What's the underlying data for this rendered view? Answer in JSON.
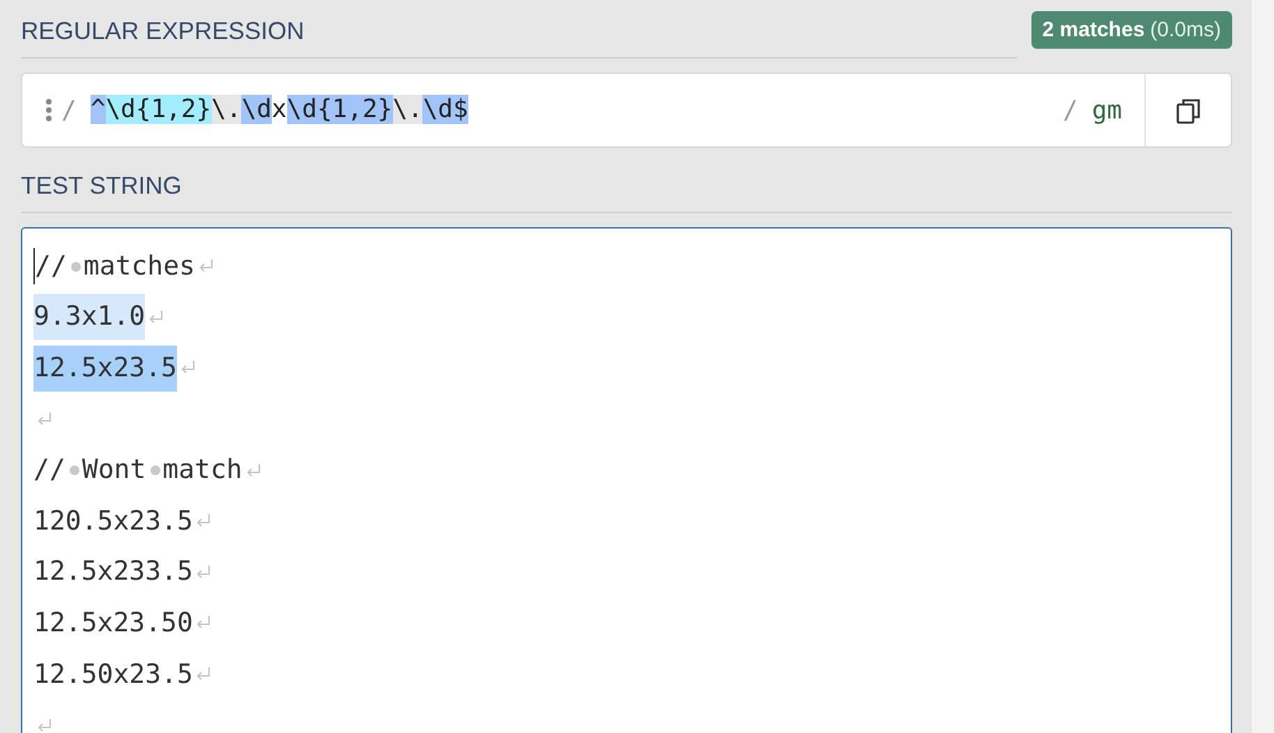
{
  "regex_section": {
    "title": "REGULAR EXPRESSION",
    "badge": {
      "count": "2 matches",
      "time": "(0.0ms)"
    },
    "delimiter_open": "/",
    "tokens": [
      {
        "text": "^",
        "color": "#a3c4f9"
      },
      {
        "text": "\\d{1,2}",
        "color": "#a3ecfb"
      },
      {
        "text": "\\.",
        "color": "#e6e6e6"
      },
      {
        "text": "\\d",
        "color": "#a3c4f9"
      },
      {
        "text": "x"
      },
      {
        "text": "\\d{1,2}",
        "color": "#a3c4f9"
      },
      {
        "text": "\\.",
        "color": "#e6e6e6"
      },
      {
        "text": "\\d$",
        "color": "#a3c4f9"
      }
    ],
    "delimiter_close": "/",
    "flags": "gm"
  },
  "test_section": {
    "title": "TEST STRING",
    "lines": [
      {
        "kind": "text",
        "text": "// matches"
      },
      {
        "kind": "text",
        "text": "9.3x1.0",
        "color": "#d5e8fc"
      },
      {
        "kind": "text",
        "text": "12.5x23.5",
        "color": "#a7d1fb"
      },
      {
        "kind": "blank"
      },
      {
        "kind": "text",
        "text": "// Wont match"
      },
      {
        "kind": "text",
        "text": "120.5x23.5"
      },
      {
        "kind": "text",
        "text": "12.5x233.5"
      },
      {
        "kind": "text",
        "text": "12.5x23.50"
      },
      {
        "kind": "text",
        "text": "12.50x23.5"
      },
      {
        "kind": "blank"
      }
    ]
  }
}
